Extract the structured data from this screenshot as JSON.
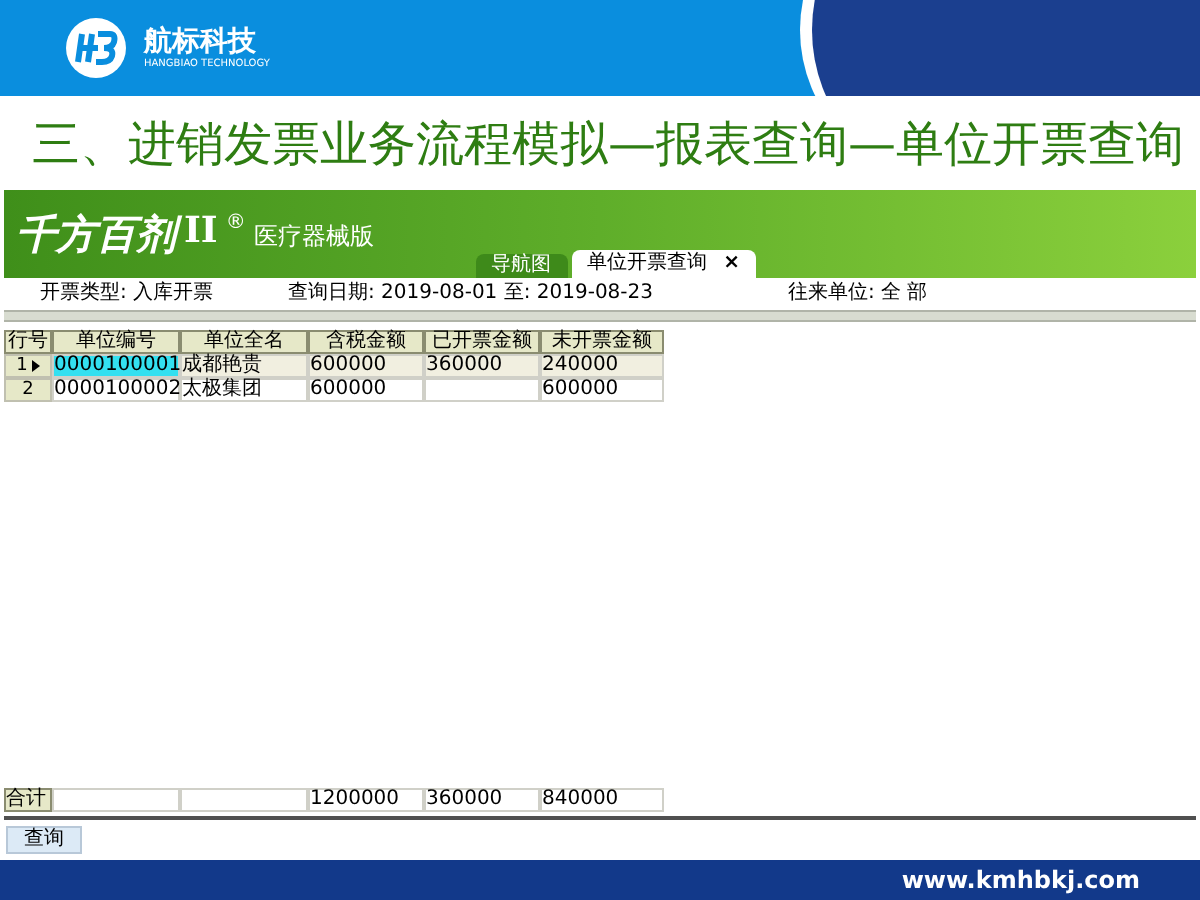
{
  "brand": {
    "name": "航标科技",
    "subtitle": "HANGBIAO TECHNOLOGY"
  },
  "slide_title": "三、进销发票业务流程模拟—报表查询—单位开票查询",
  "app": {
    "logo": "千方百剂",
    "edition_mark": "II",
    "registered": "®",
    "edition": "医疗器械版",
    "tabs": [
      {
        "label": "导航图",
        "selected": false
      },
      {
        "label": "单位开票查询",
        "selected": true,
        "close": "×"
      }
    ]
  },
  "filters": {
    "invoice_type": "开票类型: 入库开票",
    "date_range": "查询日期: 2019-08-01 至: 2019-08-23",
    "partner": "往来单位: 全  部"
  },
  "table": {
    "columns": [
      "行号",
      "单位编号",
      "单位全名",
      "含税金额",
      "已开票金额",
      "未开票金额"
    ],
    "rows": [
      {
        "selected": true,
        "cells": [
          "1",
          "0000100001",
          "成都艳贵",
          "600000",
          "360000",
          "240000"
        ]
      },
      {
        "selected": false,
        "cells": [
          "2",
          "0000100002",
          "太极集团",
          "600000",
          "",
          "600000"
        ]
      }
    ],
    "total": {
      "label": "合计",
      "cells": [
        "",
        "",
        "1200000",
        "360000",
        "840000"
      ]
    }
  },
  "query_button": "查询",
  "footer": {
    "url": "www.kmhbkj.com"
  }
}
